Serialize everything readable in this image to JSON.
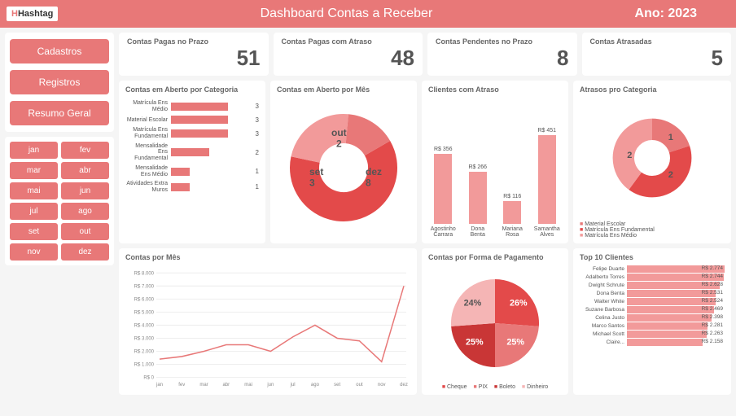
{
  "header": {
    "logo": "Hashtag",
    "title": "Dashboard Contas a Receber",
    "year_label": "Ano: 2023"
  },
  "nav": [
    "Cadastros",
    "Registros",
    "Resumo Geral"
  ],
  "months": [
    "jan",
    "fev",
    "mar",
    "abr",
    "mai",
    "jun",
    "jul",
    "ago",
    "set",
    "out",
    "nov",
    "dez"
  ],
  "kpis": [
    {
      "label": "Contas Pagas no Prazo",
      "value": "51"
    },
    {
      "label": "Contas Pagas com Atraso",
      "value": "48"
    },
    {
      "label": "Contas Pendentes no Prazo",
      "value": "8"
    },
    {
      "label": "Contas Atrasadas",
      "value": "5"
    }
  ],
  "card_titles": {
    "cat": "Contas em Aberto por Categoria",
    "mes": "Contas em Aberto por Mês",
    "cli": "Clientes com Atraso",
    "atr": "Atrasos pro Categoria",
    "lin": "Contas por Mês",
    "pag": "Contas por Forma de Pagamento",
    "top": "Top 10 Clientes"
  },
  "chart_data": {
    "contas_aberto_categoria": {
      "type": "bar",
      "orientation": "horizontal",
      "categories": [
        "Matrícula Ens Médio",
        "Material Escolar",
        "Matrícula Ens Fundamental",
        "Mensalidade Ens Fundamental",
        "Mensalidade Ens Médio",
        "Atividades Extra Muros"
      ],
      "values": [
        3,
        3,
        3,
        2,
        1,
        1
      ],
      "max": 3
    },
    "contas_aberto_mes": {
      "type": "pie",
      "donut": true,
      "slices": [
        {
          "label": "dez",
          "value": 8
        },
        {
          "label": "set",
          "value": 3
        },
        {
          "label": "out",
          "value": 2
        }
      ]
    },
    "clientes_atraso": {
      "type": "bar",
      "categories": [
        "Agostinho Carrara",
        "Dona Benta",
        "Mariana Rosa",
        "Samantha Alves"
      ],
      "values": [
        356,
        266,
        116,
        451
      ],
      "prefix": "R$ ",
      "max": 500
    },
    "atrasos_categoria": {
      "type": "pie",
      "donut": true,
      "slices": [
        {
          "label": "Material Escolar",
          "value": 1
        },
        {
          "label": "Matrícula Ens Fundamental",
          "value": 2
        },
        {
          "label": "Matrícula Ens Médio",
          "value": 2
        }
      ]
    },
    "contas_por_mes": {
      "type": "line",
      "x": [
        "jan",
        "fev",
        "mar",
        "abr",
        "mai",
        "jun",
        "jul",
        "ago",
        "set",
        "out",
        "nov",
        "dez"
      ],
      "y": [
        1400,
        1600,
        2000,
        2500,
        2500,
        2000,
        3100,
        4000,
        3000,
        2800,
        1200,
        7000
      ],
      "ylim": [
        0,
        8000
      ],
      "yticks": [
        "R$ 0",
        "R$ 1.000",
        "R$ 2.000",
        "R$ 3.000",
        "R$ 4.000",
        "R$ 5.000",
        "R$ 6.000",
        "R$ 7.000",
        "R$ 8.000"
      ]
    },
    "forma_pagamento": {
      "type": "pie",
      "slices": [
        {
          "label": "Cheque",
          "value": 26
        },
        {
          "label": "PIX",
          "value": 25
        },
        {
          "label": "Boleto",
          "value": 25
        },
        {
          "label": "Dinheiro",
          "value": 24
        }
      ]
    },
    "top10": {
      "type": "bar",
      "orientation": "horizontal",
      "prefix": "R$ ",
      "categories": [
        "Felipe Duarte",
        "Adalberto Torres",
        "Dwight Schrute",
        "Dona Benta",
        "Walter White",
        "Suzane Barbosa",
        "Celina Justo",
        "Marco Santos",
        "Michael Scott",
        "Claire..."
      ],
      "values": [
        2774,
        2744,
        2628,
        2531,
        2524,
        2469,
        2398,
        2281,
        2263,
        2158
      ],
      "max": 2774
    }
  },
  "legends": {
    "atr": [
      "Material Escolar",
      "Matrícula Ens Fundamental",
      "Matrícula Ens Médio"
    ],
    "pag": [
      "Cheque",
      "PIX",
      "Boleto",
      "Dinheiro"
    ]
  }
}
